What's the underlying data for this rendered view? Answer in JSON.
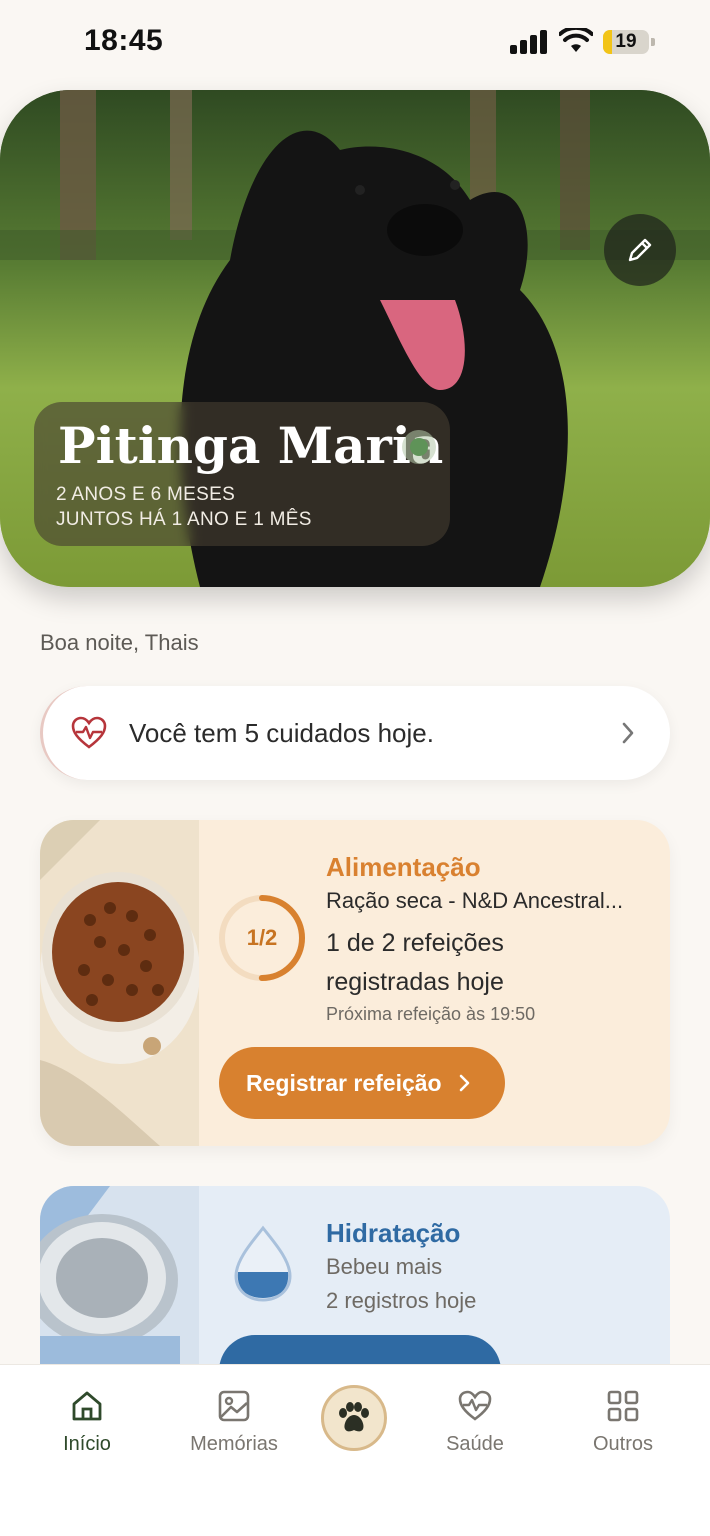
{
  "status_bar": {
    "time": "18:45",
    "battery": "19",
    "battery_level": 0.19
  },
  "pet": {
    "name": "Pitinga Maria",
    "age": "2 ANOS E 6 MESES",
    "together": "JUNTOS HÁ 1 ANO E 1 MÊS"
  },
  "greeting": "Boa noite, Thais",
  "care_banner": {
    "text": "Você tem 5 cuidados hoje."
  },
  "food_card": {
    "title": "Alimentação",
    "description": "Ração seca - N&D Ancestral...",
    "progress_label": "1/2",
    "progress_fraction": 0.5,
    "meals_text": "1 de 2 refeições registradas hoje",
    "next_meal": "Próxima refeição às 19:50",
    "button_label": "Registrar refeição"
  },
  "water_card": {
    "title": "Hidratação",
    "line1": "Bebeu mais",
    "line2": "2 registros hoje"
  },
  "tab_bar": {
    "items": [
      {
        "label": "Início",
        "icon": "home-icon",
        "active": true
      },
      {
        "label": "Memórias",
        "icon": "image-icon",
        "active": false
      },
      {
        "label": "",
        "icon": "paw-icon",
        "active": false
      },
      {
        "label": "Saúde",
        "icon": "heart-pulse-icon",
        "active": false
      },
      {
        "label": "Outros",
        "icon": "grid-icon",
        "active": false
      }
    ]
  },
  "colors": {
    "food_accent": "#d8812f",
    "water_accent": "#2f6aa3",
    "active_tab": "#2f4a2b",
    "background": "#faf7f3"
  }
}
